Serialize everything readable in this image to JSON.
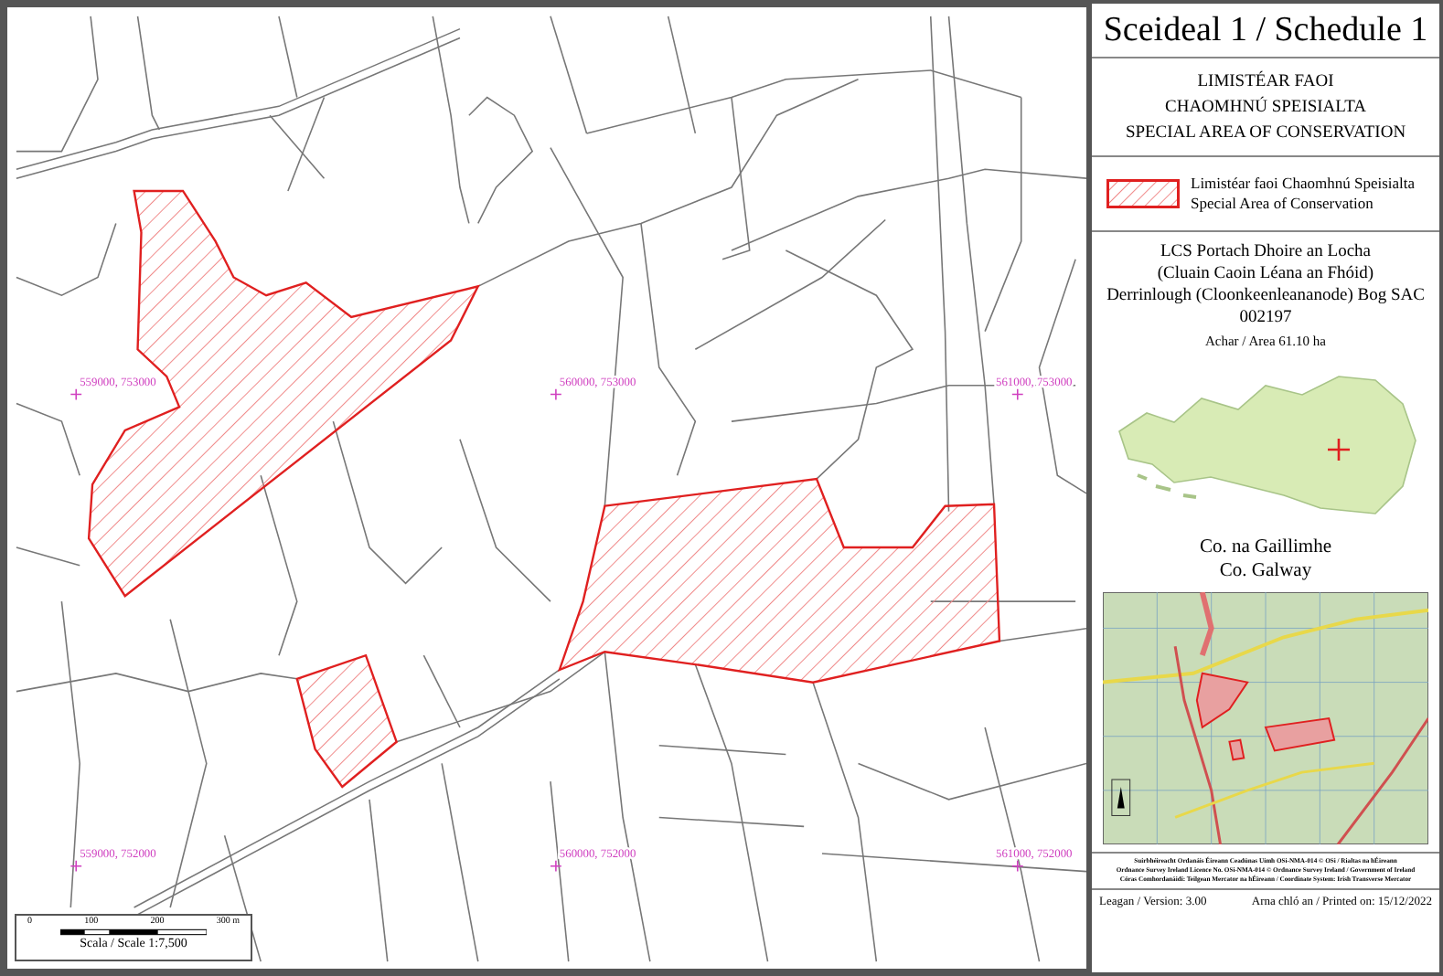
{
  "map": {
    "grid_labels": [
      "559000, 753000",
      "560000, 753000",
      "561000, 753000",
      "559000, 752000",
      "560000, 752000",
      "561000, 752000"
    ],
    "conservation_areas": [
      {
        "kind": "hatched"
      },
      {
        "kind": "hatched"
      },
      {
        "kind": "hatched"
      }
    ],
    "scale_bar": {
      "ticks": [
        "0",
        "100",
        "200",
        "300 m"
      ],
      "caption": "Scala / Scale  1:7,500"
    }
  },
  "panel": {
    "title": "Sceideal 1 / Schedule 1",
    "heading": [
      "LIMISTÉAR FAOI",
      "CHAOMHNÚ SPEISIALTA",
      "SPECIAL AREA OF CONSERVATION"
    ],
    "legend": {
      "label_lines": [
        "Limistéar faoi Chaomhnú Speisialta",
        "Special Area of Conservation"
      ]
    },
    "site": {
      "name_lines": [
        "LCS Portach Dhoire an Locha",
        "(Cluain Caoin Léana an Fhóid)",
        "Derrinlough (Cloonkeenleananode) Bog SAC"
      ],
      "code": "002197",
      "area": "Achar / Area 61.10 ha"
    },
    "county": [
      "Co. na Gaillimhe",
      "Co. Galway"
    ],
    "credits": [
      "Suirbhéireacht Ordanáis Éireann Ceadúnas Uimh OSi-NMA-014 © OSi / Rialtas na hÉireann",
      "Ordnance Survey Ireland Licence No. OSi-NMA-014 © Ordnance Survey Ireland / Government of Ireland",
      "Córas Comhordanáidí: Teilgean Mercator na hÉireann / Coordinate System: Irish Transverse Mercator"
    ],
    "version": "Leagan / Version: 3.00",
    "printed": "Arna chló an / Printed on: 15/12/2022"
  }
}
